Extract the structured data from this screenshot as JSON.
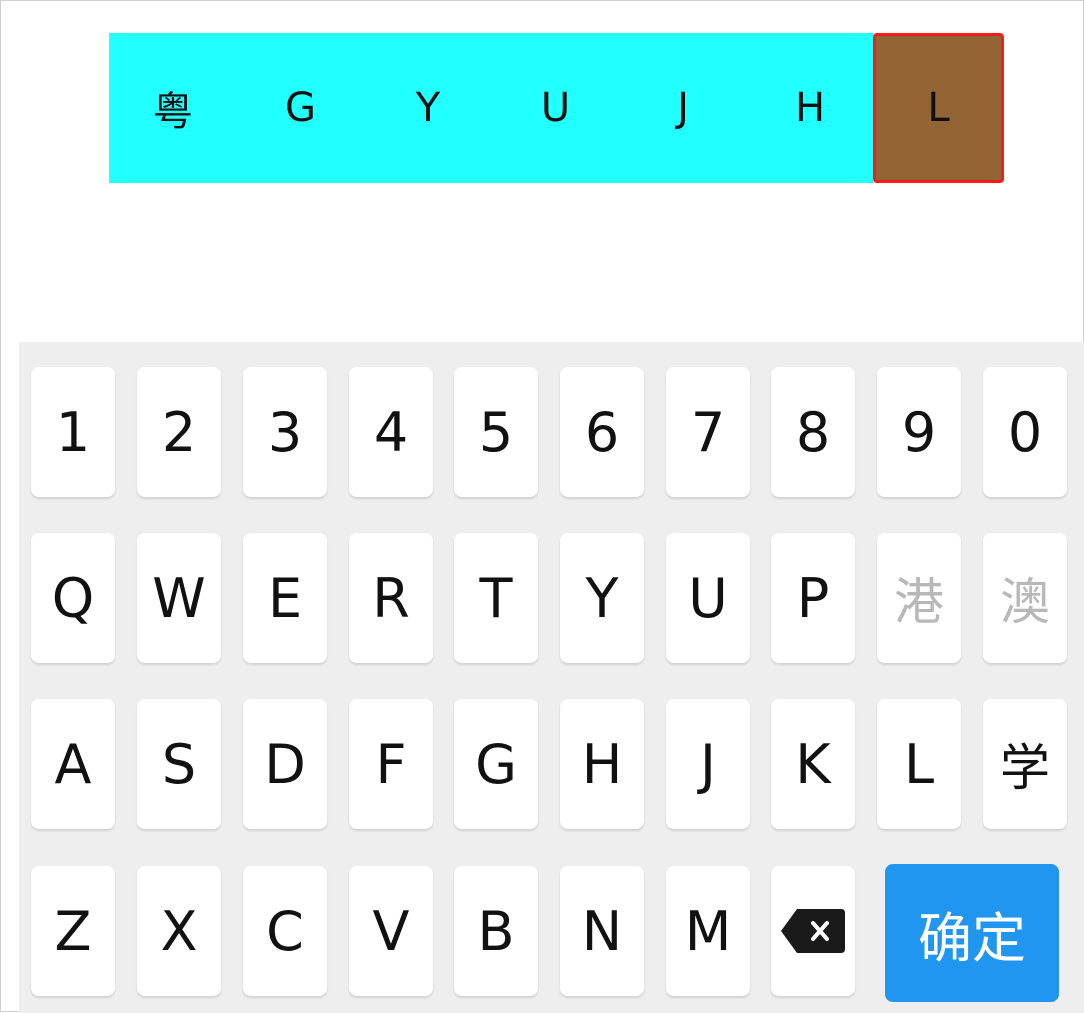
{
  "plate": {
    "cells": [
      "粤",
      "G",
      "Y",
      "U",
      "J",
      "H",
      "L"
    ],
    "active_index": 6
  },
  "keyboard": {
    "row1": [
      "1",
      "2",
      "3",
      "4",
      "5",
      "6",
      "7",
      "8",
      "9",
      "0"
    ],
    "row2": [
      "Q",
      "W",
      "E",
      "R",
      "T",
      "Y",
      "U",
      "P",
      "港",
      "澳"
    ],
    "row3": [
      "A",
      "S",
      "D",
      "F",
      "G",
      "H",
      "J",
      "K",
      "L",
      "学"
    ],
    "row4": [
      "Z",
      "X",
      "C",
      "V",
      "B",
      "N",
      "M"
    ],
    "delete_icon": "backspace-icon",
    "confirm_label": "确定"
  },
  "colors": {
    "plate_fill": "#22ffff",
    "active_fill": "#936434",
    "active_border": "#ff1a1a",
    "keyboard_bg": "#eeeeee",
    "confirm_bg": "#2196f0",
    "disabled_key_text": "#b8b8b8"
  }
}
